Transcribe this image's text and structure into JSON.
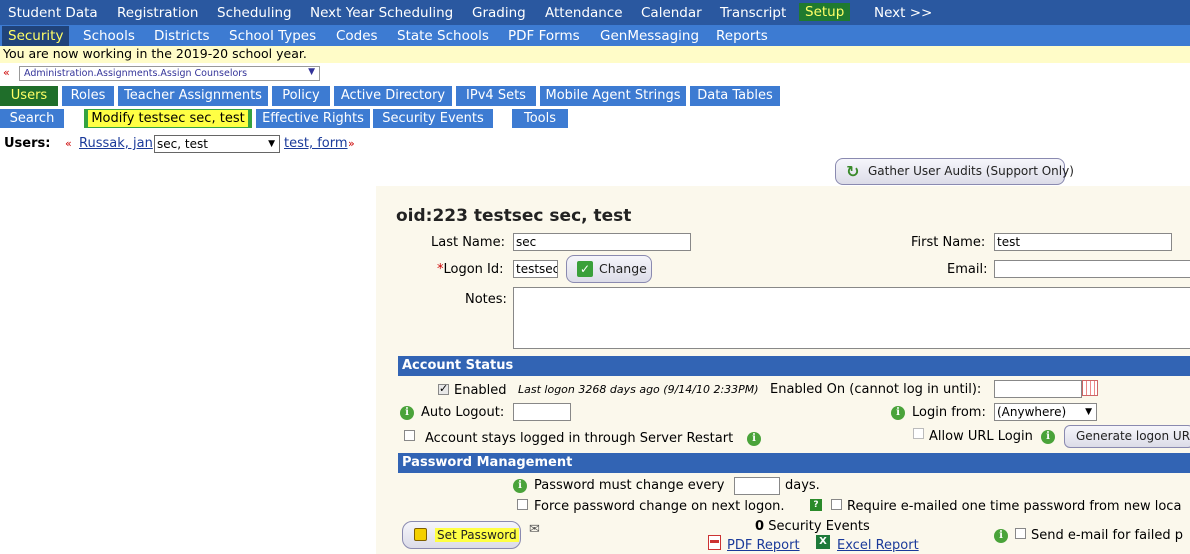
{
  "topnav": {
    "items": [
      "Student Data",
      "Registration",
      "Scheduling",
      "Next Year Scheduling",
      "Grading",
      "Attendance",
      "Calendar",
      "Transcript",
      "Setup",
      "Next >>"
    ]
  },
  "subnav": {
    "items": [
      "Security",
      "Schools",
      "Districts",
      "School Types",
      "Codes",
      "State Schools",
      "PDF Forms",
      "GenMessaging",
      "Reports"
    ]
  },
  "year_notice": "You are now working in the 2019-20 school year.",
  "crumb": {
    "prev": "«",
    "selected": "Administration.Assignments.Assign Counselors"
  },
  "tabs1": [
    "Users",
    "Roles",
    "Teacher Assignments",
    "Policy",
    "Active Directory",
    "IPv4 Sets",
    "Mobile Agent Strings",
    "Data Tables"
  ],
  "tabs2": [
    "Search",
    "Modify testsec sec, test",
    "Effective Rights",
    "Security Events",
    "Tools"
  ],
  "users_row": {
    "label": "Users:",
    "prev_arrow": "«",
    "prev": "Russak, jan",
    "current": "sec, test",
    "next": "test, form",
    "next_arrow": "»"
  },
  "audit_button": "Gather User Audits (Support Only)",
  "form": {
    "title": "oid:223 testsec sec, test",
    "last_name_label": "Last Name:",
    "last_name": "sec",
    "first_name_label": "First Name:",
    "first_name": "test",
    "logon_req": "*",
    "logon_label": "Logon Id:",
    "logon": "testsec",
    "change_button": "Change",
    "email_label": "Email:",
    "email": "",
    "notes_label": "Notes:"
  },
  "account_status": {
    "header": "Account Status",
    "enabled_label": "Enabled",
    "last_logon": "Last logon 3268 days ago (9/14/10 2:33PM)",
    "enabled_on_label": "Enabled On (cannot log in until):",
    "auto_logout_label": "Auto Logout:",
    "login_from_label": "Login from:",
    "login_from": "(Anywhere)",
    "stay_logged_label": "Account stays logged in through Server Restart",
    "allow_url_label": "Allow URL Login",
    "gen_url_button": "Generate logon URL"
  },
  "password": {
    "header": "Password Management",
    "change_every_label": "Password must change every",
    "days_label": "days.",
    "force_label": "Force password change on next logon.",
    "require_email_label": "Require e-mailed one time password from new loca",
    "set_password_button": "Set Password",
    "events_count": "0",
    "events_label": "Security Events",
    "pdf_report": "PDF Report",
    "excel_report": "Excel Report",
    "send_email_label": "Send e-mail for failed p"
  }
}
